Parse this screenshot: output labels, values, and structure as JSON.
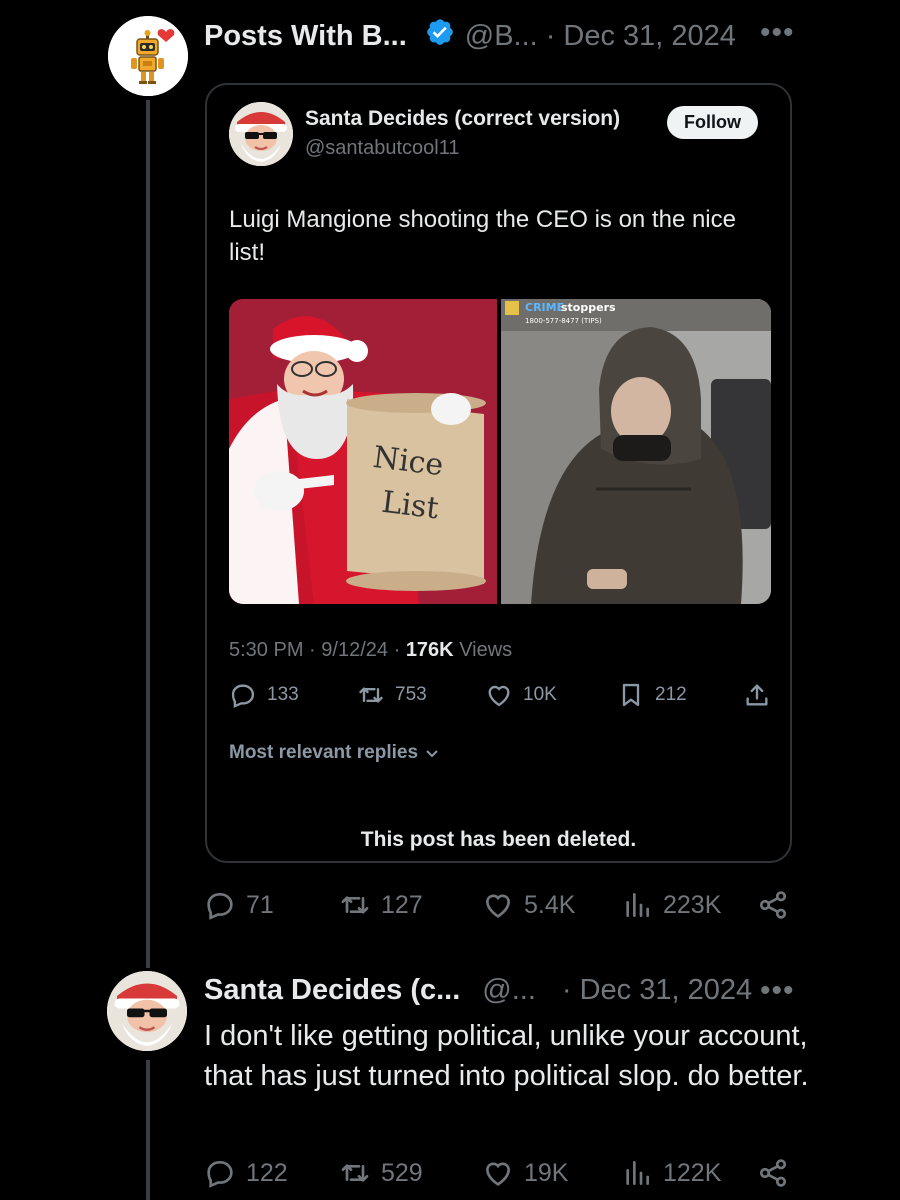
{
  "post1": {
    "display_name": "Posts With B...",
    "handle": "@B...",
    "separator": "·",
    "date": "Dec 31, 2024",
    "more": "•••",
    "stats": {
      "replies": "71",
      "reposts": "127",
      "likes": "5.4K",
      "views": "223K"
    }
  },
  "quote": {
    "display_name": "Santa Decides (correct version)",
    "handle": "@santabutcool11",
    "follow_label": "Follow",
    "text": "Luigi Mangione shooting the CEO is on the nice list!",
    "media_left": {
      "scroll_line1": "Nice",
      "scroll_line2": "List"
    },
    "media_right": {
      "brand_a": "CRIME",
      "brand_b": "stoppers",
      "phone": "1800-577-8477 (TIPS)"
    },
    "time": "5:30 PM",
    "meta_sep": "·",
    "date": "9/12/24",
    "views_count": "176K",
    "views_label": "Views",
    "stats": {
      "replies": "133",
      "reposts": "753",
      "likes": "10K",
      "bookmarks": "212"
    },
    "most_relevant": "Most relevant replies",
    "deleted_notice": "This post has been deleted."
  },
  "post2": {
    "display_name": "Santa Decides (c...",
    "handle": "@...",
    "separator": "·",
    "date": "Dec 31, 2024",
    "more": "•••",
    "text": "I don't like getting political, unlike your account, that has just turned into political slop. do better.",
    "stats": {
      "replies": "122",
      "reposts": "529",
      "likes": "19K",
      "views": "122K"
    }
  },
  "colors": {
    "background": "#000000",
    "text": "#e7e9ea",
    "muted": "#71767b",
    "verified": "#1d9bf0",
    "border": "#2f3336"
  }
}
